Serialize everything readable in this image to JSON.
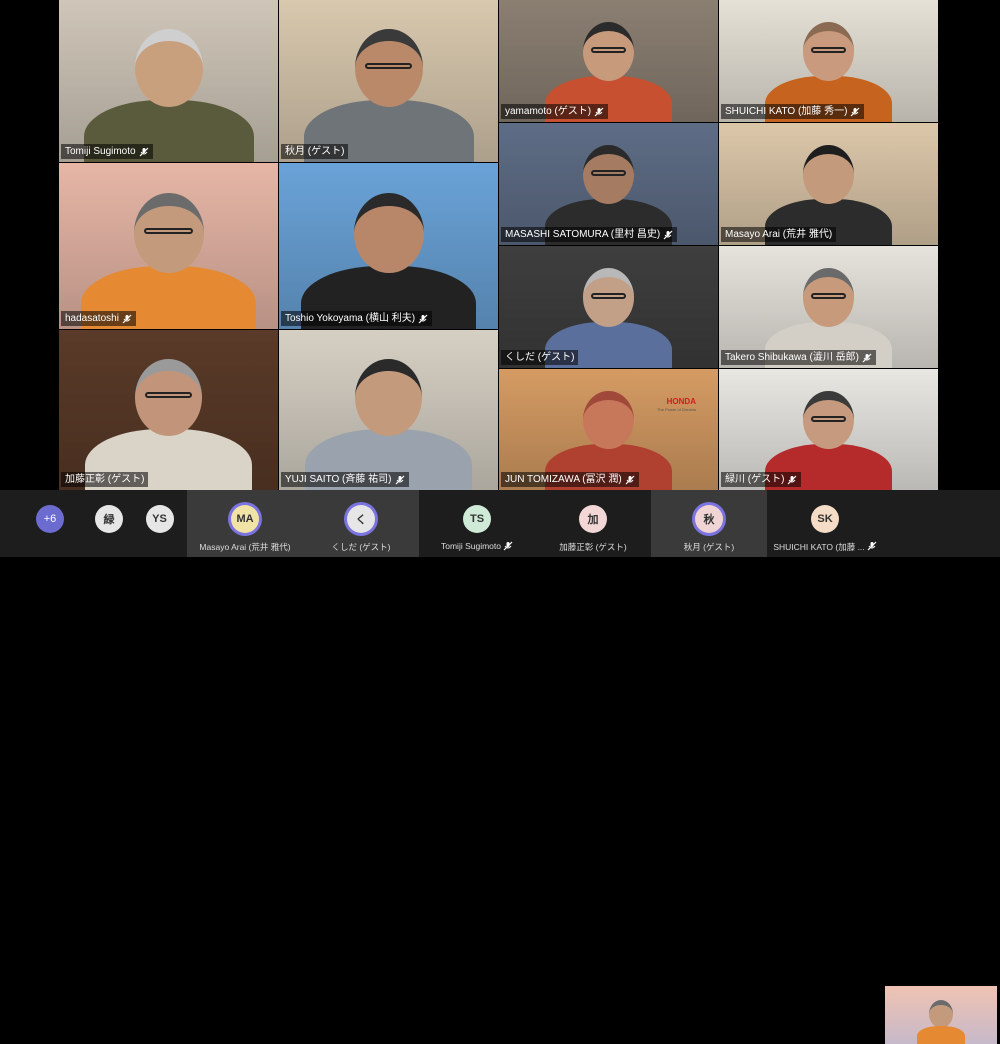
{
  "grid": {
    "tiles": [
      {
        "name": "Tomiji Sugimoto",
        "muted": true,
        "bg": "#cfc6b8",
        "shirt": "#5a5a3c",
        "skin": "#c9a07d",
        "hair": "#cfcfcf",
        "glasses": false
      },
      {
        "name": "秋月 (ゲスト)",
        "muted": false,
        "bg": "#d8c8ae",
        "shirt": "#6f7479",
        "skin": "#b9896a",
        "hair": "#3a3a3a",
        "glasses": true
      },
      {
        "name": "yamamoto (ゲスト)",
        "muted": true,
        "bg": "#8b7f72",
        "shirt": "#c65030",
        "skin": "#c79a7c",
        "hair": "#2b2b2b",
        "glasses": true
      },
      {
        "name": "SHUICHI KATO (加藤 秀一)",
        "muted": true,
        "bg": "#e6e1d6",
        "shirt": "#c6631e",
        "skin": "#c99a7d",
        "hair": "#8a6a52",
        "glasses": true
      },
      {
        "name": "hadasatoshi",
        "muted": true,
        "bg": "#e6b6a6",
        "shirt": "#e58a33",
        "skin": "#c49a7c",
        "hair": "#6b6b6b",
        "glasses": true
      },
      {
        "name": "Toshio Yokoyama (横山 利夫)",
        "muted": true,
        "bg": "#6aa3d8",
        "shirt": "#222222",
        "skin": "#b8876a",
        "hair": "#2a2a2a",
        "glasses": false
      },
      {
        "name": "MASASHI SATOMURA (里村 昌史)",
        "muted": true,
        "bg": "#5e6d86",
        "shirt": "#2c2c2c",
        "skin": "#a57b62",
        "hair": "#2a2a2a",
        "glasses": true
      },
      {
        "name": "Masayo Arai (荒井 雅代)",
        "muted": false,
        "bg": "#dcc7a9",
        "shirt": "#2c2c2c",
        "skin": "#c49a7c",
        "hair": "#1e1e1e",
        "glasses": false
      },
      {
        "name": "加藤正彰 (ゲスト)",
        "muted": false,
        "bg": "#5a3a28",
        "shirt": "#d9d3c8",
        "skin": "#c2957a",
        "hair": "#9a9a9a",
        "glasses": true
      },
      {
        "name": "YUJI SAITO (斉藤 祐司)",
        "muted": true,
        "bg": "#d6d0c4",
        "shirt": "#9aa3ad",
        "skin": "#c49a7c",
        "hair": "#2a2a2a",
        "glasses": false
      },
      {
        "name": "くしだ (ゲスト)",
        "muted": false,
        "bg": "#3e3e3e",
        "shirt": "#5b6f9c",
        "skin": "#c2a088",
        "hair": "#b8b8b8",
        "glasses": true
      },
      {
        "name": "Takero Shibukawa (澁川 岳郎)",
        "muted": true,
        "bg": "#e6e3dc",
        "shirt": "#d4cfc6",
        "skin": "#c79a7c",
        "hair": "#6a6a6a",
        "glasses": true
      },
      {
        "name": "",
        "muted": false,
        "bg": "#20201e",
        "shirt": "#c9c3b8",
        "skin": "#c7a08a",
        "hair": "#d0d0d0",
        "glasses": true
      },
      {
        "name": "",
        "muted": false,
        "bg": "#e0dbd2",
        "shirt": "#3c5a8c",
        "skin": "#c49a7c",
        "hair": "#2a2a2a",
        "glasses": false
      },
      {
        "name": "JUN TOMIZAWA (冨沢 潤)",
        "muted": true,
        "bg": "#d59b63",
        "shirt": "#b04030",
        "skin": "#c8785a",
        "hair": "#a0483a",
        "glasses": false
      },
      {
        "name": "緑川 (ゲスト)",
        "muted": true,
        "bg": "#e9e7e2",
        "shirt": "#b52a2a",
        "skin": "#c69a7e",
        "hair": "#3a3a3a",
        "glasses": true
      }
    ],
    "honda_logo": "HONDA",
    "honda_tagline": "The Power of Dreams"
  },
  "bottom_bar": {
    "overflow_count": "+6",
    "chips": [
      {
        "initials": "緑",
        "name": "",
        "color": "#e6e6e6",
        "speaker": false,
        "ring": false,
        "muted": false
      },
      {
        "initials": "YS",
        "name": "",
        "color": "#e6e6e6",
        "speaker": false,
        "ring": false,
        "muted": false
      },
      {
        "initials": "MA",
        "name": "Masayo Arai (荒井 雅代)",
        "color": "#f1e3a6",
        "speaker": true,
        "ring": true,
        "muted": false
      },
      {
        "initials": "く",
        "name": "くしだ (ゲスト)",
        "color": "#e6e6e6",
        "speaker": true,
        "ring": true,
        "muted": false
      },
      {
        "initials": "TS",
        "name": "Tomiji Sugimoto",
        "color": "#cfead6",
        "speaker": false,
        "ring": false,
        "muted": true
      },
      {
        "initials": "加",
        "name": "加藤正彰 (ゲスト)",
        "color": "#f3d6d6",
        "speaker": false,
        "ring": false,
        "muted": false
      },
      {
        "initials": "秋",
        "name": "秋月 (ゲスト)",
        "color": "#f1d4d4",
        "speaker": true,
        "ring": true,
        "muted": false
      },
      {
        "initials": "SK",
        "name": "SHUICHI KATO (加藤 ...",
        "color": "#f4dcc6",
        "speaker": false,
        "ring": false,
        "muted": true
      }
    ]
  },
  "colors": {
    "speaker_ring": "#7b74e0",
    "bar_bg": "#1d1d1d"
  },
  "icons": {
    "mic_off": "mic-off-icon"
  }
}
